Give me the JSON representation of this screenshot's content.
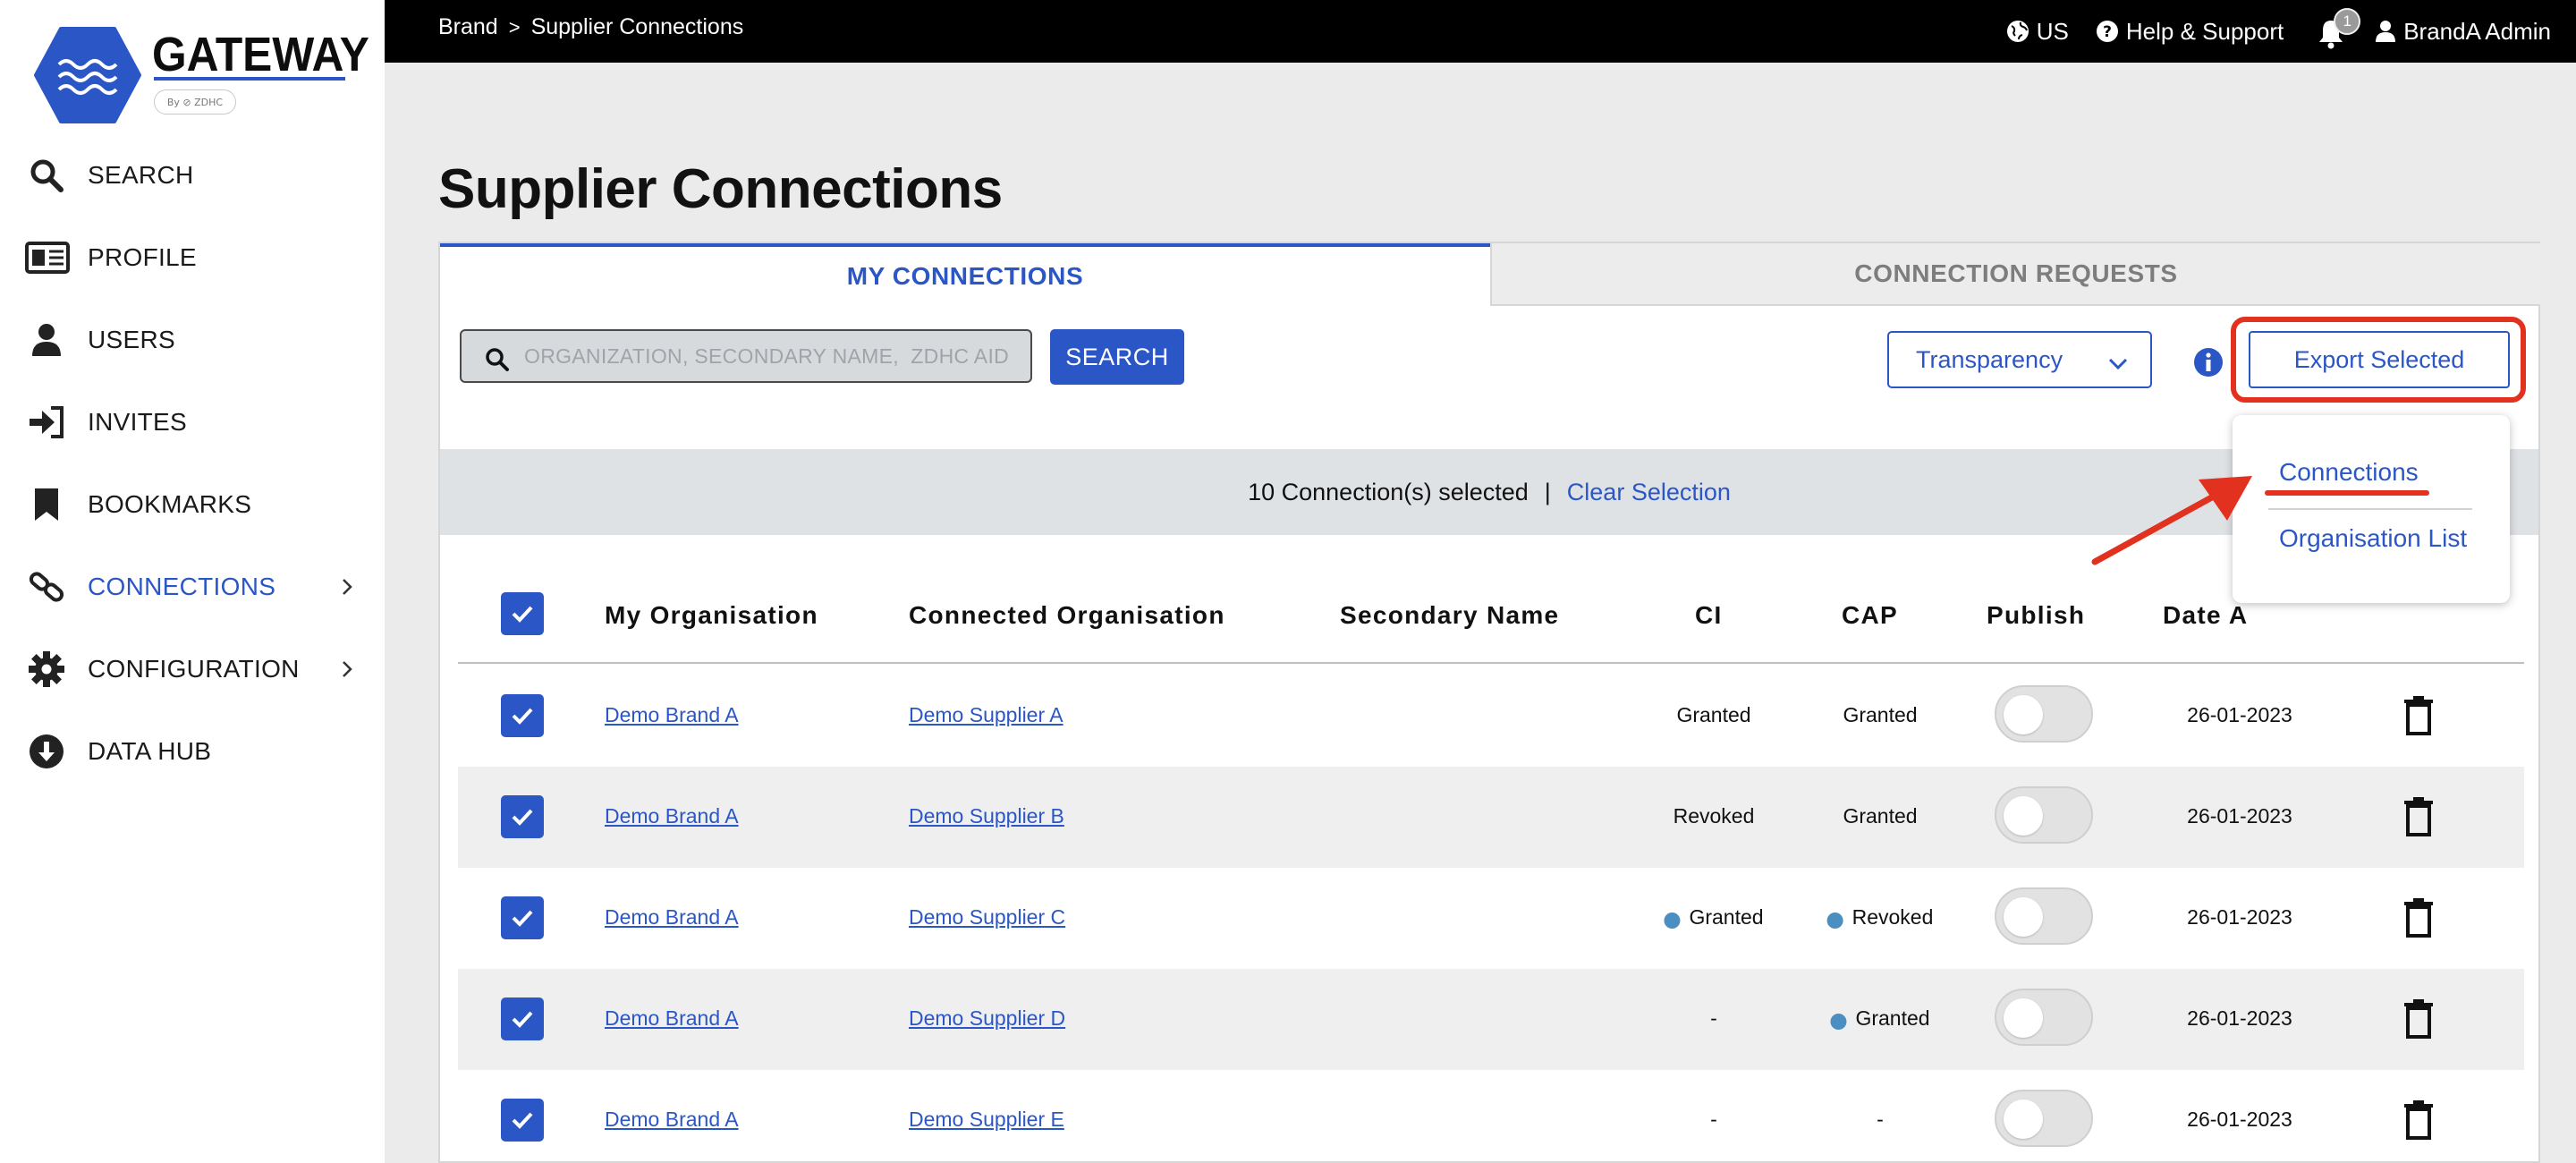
{
  "brand": {
    "wordmark": "GATEWAY",
    "by": "By ⊘ ZDHC"
  },
  "sidebar": {
    "items": [
      {
        "label": "SEARCH",
        "icon": "search-icon"
      },
      {
        "label": "PROFILE",
        "icon": "profile-card-icon"
      },
      {
        "label": "USERS",
        "icon": "user-icon"
      },
      {
        "label": "INVITES",
        "icon": "sign-in-icon"
      },
      {
        "label": "BOOKMARKS",
        "icon": "bookmark-icon"
      },
      {
        "label": "CONNECTIONS",
        "icon": "link-icon",
        "active": true
      },
      {
        "label": "CONFIGURATION",
        "icon": "gear-icon"
      },
      {
        "label": "DATA HUB",
        "icon": "download-circle-icon"
      }
    ]
  },
  "topbar": {
    "breadcrumb": [
      "Brand",
      "Supplier Connections"
    ],
    "breadcrumb_sep": ">",
    "region": "US",
    "help": "Help & Support",
    "notification_count": "1",
    "user": "BrandA Admin"
  },
  "page": {
    "title": "Supplier Connections"
  },
  "tabs": {
    "my": "MY CONNECTIONS",
    "requests": "CONNECTION REQUESTS"
  },
  "toolbar": {
    "search_placeholder": "ORGANIZATION, SECONDARY NAME,  ZDHC AID",
    "search_value": "",
    "search_button": "SEARCH",
    "filter_selected": "Transparency",
    "export_button": "Export Selected"
  },
  "selection": {
    "count_text": "10 Connection(s) selected",
    "separator": "|",
    "clear": "Clear Selection"
  },
  "table": {
    "headers": [
      "My Organisation",
      "Connected Organisation",
      "Secondary Name",
      "CI",
      "CAP",
      "Publish",
      "Date A"
    ],
    "rows": [
      {
        "my_org": "Demo Brand A",
        "connected": "Demo Supplier A",
        "secondary": "",
        "ci": "Granted",
        "ci_dot": false,
        "cap": "Granted",
        "cap_dot": false,
        "publish": false,
        "date": "26-01-2023"
      },
      {
        "my_org": "Demo Brand A",
        "connected": "Demo Supplier B",
        "secondary": "",
        "ci": "Revoked",
        "ci_dot": false,
        "cap": "Granted",
        "cap_dot": false,
        "publish": false,
        "date": "26-01-2023"
      },
      {
        "my_org": "Demo Brand A",
        "connected": "Demo Supplier C",
        "secondary": "",
        "ci": "Granted",
        "ci_dot": true,
        "cap": "Revoked",
        "cap_dot": true,
        "publish": false,
        "date": "26-01-2023"
      },
      {
        "my_org": "Demo Brand A",
        "connected": "Demo Supplier D",
        "secondary": "",
        "ci": "-",
        "ci_dot": false,
        "cap": "Granted",
        "cap_dot": true,
        "publish": false,
        "date": "26-01-2023"
      },
      {
        "my_org": "Demo Brand A",
        "connected": "Demo Supplier E",
        "secondary": "",
        "ci": "-",
        "ci_dot": false,
        "cap": "-",
        "cap_dot": false,
        "publish": false,
        "date": "26-01-2023"
      }
    ]
  },
  "export_menu": {
    "items": [
      "Connections",
      "Organisation List"
    ]
  },
  "colors": {
    "accent": "#2b56c5",
    "highlight": "#e3311f",
    "status_dot": "#4b8fc2",
    "topbar": "#000000"
  }
}
